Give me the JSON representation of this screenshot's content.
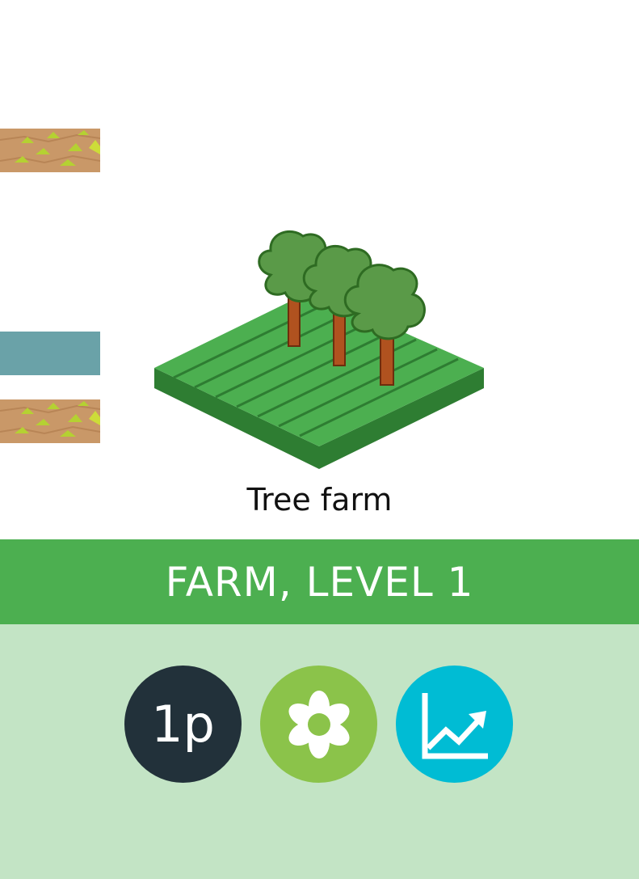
{
  "card": {
    "building_name": "Tree farm",
    "title": "FARM, LEVEL 1"
  },
  "badges": [
    {
      "text": "1p",
      "icon": "players-icon",
      "color": "#22313a"
    },
    {
      "text": "",
      "icon": "flower-icon",
      "color": "#8bc34a"
    },
    {
      "text": "",
      "icon": "growth-chart-icon",
      "color": "#00bcd4"
    }
  ],
  "colors": {
    "title_bar": "#4caf50",
    "panel": "#c3e4c5",
    "water": "#6aa2a8",
    "dirt": "#c99868",
    "field_light": "#4caf50",
    "field_dark": "#2e7d32",
    "tree_leaves": "#5a9a48",
    "tree_trunk": "#b0521f"
  }
}
